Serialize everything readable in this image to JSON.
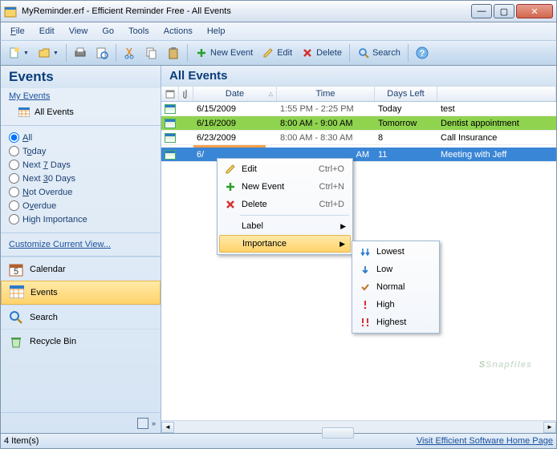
{
  "window": {
    "title": "MyReminder.erf - Efficient Reminder Free - All Events"
  },
  "menu": {
    "file": "File",
    "edit": "Edit",
    "view": "View",
    "go": "Go",
    "tools": "Tools",
    "actions": "Actions",
    "help": "Help"
  },
  "toolbar": {
    "new_event": "New Event",
    "edit": "Edit",
    "delete": "Delete",
    "search": "Search"
  },
  "sidebar": {
    "heading": "Events",
    "my_events": "My Events",
    "all_events": "All Events",
    "filters": {
      "all": "All",
      "today": "Today",
      "next7": "Next 7 Days",
      "next30": "Next 30 Days",
      "not_overdue": "Not Overdue",
      "overdue": "Overdue",
      "high": "High Importance"
    },
    "customize": "Customize Current View...",
    "nav": {
      "calendar": "Calendar",
      "events": "Events",
      "search": "Search",
      "recycle": "Recycle Bin"
    }
  },
  "main": {
    "heading": "All Events",
    "columns": {
      "date": "Date",
      "time": "Time",
      "days_left": "Days Left"
    },
    "rows": [
      {
        "date": "6/15/2009",
        "time": "1:55 PM - 2:25 PM",
        "days_left": "Today",
        "subject": "test"
      },
      {
        "date": "6/16/2009",
        "time": "8:00 AM - 9:00 AM",
        "days_left": "Tomorrow",
        "subject": "Dentist appointment"
      },
      {
        "date": "6/23/2009",
        "time": "8:00 AM - 8:30 AM",
        "days_left": "8",
        "subject": "Call Insurance"
      },
      {
        "date": "6/",
        "time": "AM",
        "days_left": "11",
        "subject": "Meeting with Jeff"
      }
    ]
  },
  "context1": {
    "edit": "Edit",
    "edit_key": "Ctrl+O",
    "new": "New Event",
    "new_key": "Ctrl+N",
    "delete": "Delete",
    "delete_key": "Ctrl+D",
    "label": "Label",
    "importance": "Importance"
  },
  "context2": {
    "lowest": "Lowest",
    "low": "Low",
    "normal": "Normal",
    "high": "High",
    "highest": "Highest"
  },
  "status": {
    "items": "4 Item(s)",
    "link": "Visit Efficient Software Home Page"
  },
  "watermark": "Snapfiles"
}
